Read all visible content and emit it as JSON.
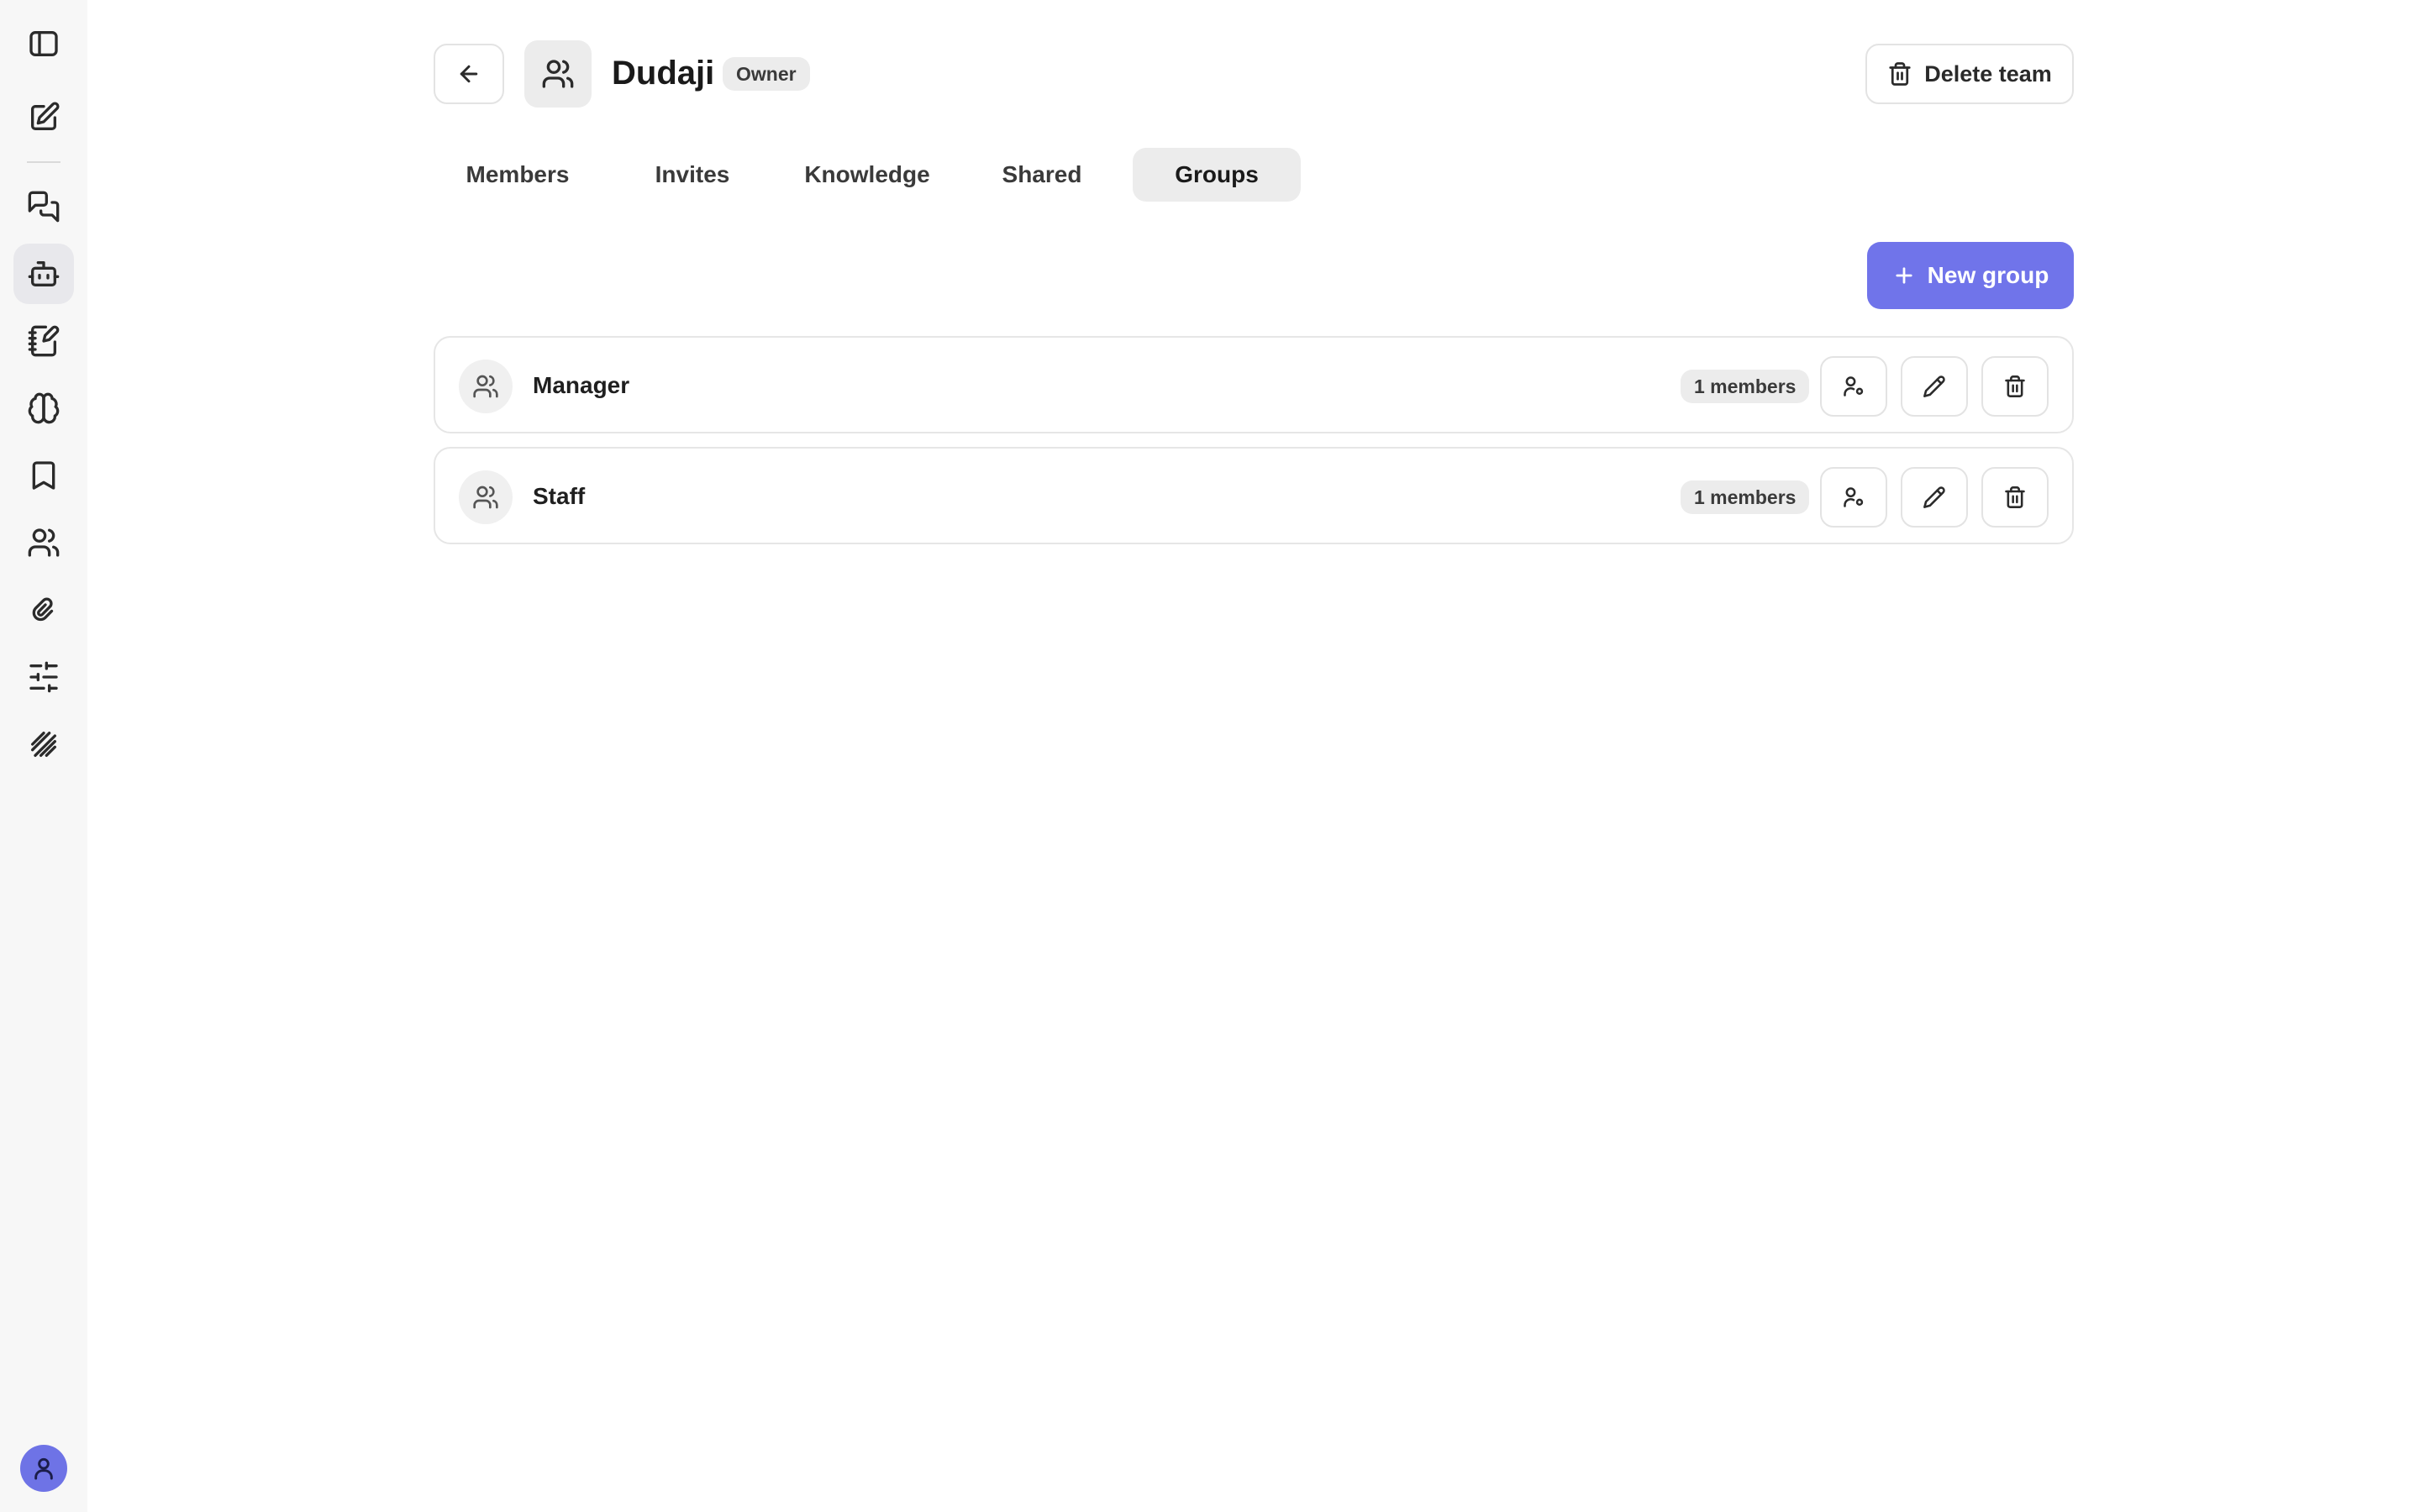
{
  "sidebar": {
    "items": [
      {
        "icon": "sidebar-toggle-icon"
      },
      {
        "icon": "new-chat-icon"
      },
      {
        "icon": "chats-icon"
      },
      {
        "icon": "bot-icon",
        "active": true
      },
      {
        "icon": "notebook-icon"
      },
      {
        "icon": "brain-icon"
      },
      {
        "icon": "bookmark-icon"
      },
      {
        "icon": "users-icon"
      },
      {
        "icon": "paperclip-icon"
      },
      {
        "icon": "sliders-icon"
      },
      {
        "icon": "scribble-icon"
      }
    ],
    "avatar_icon": "user-icon"
  },
  "header": {
    "team_name": "Dudaji",
    "role_badge": "Owner",
    "delete_label": "Delete team"
  },
  "tabs": [
    {
      "label": "Members"
    },
    {
      "label": "Invites"
    },
    {
      "label": "Knowledge"
    },
    {
      "label": "Shared"
    },
    {
      "label": "Groups",
      "active": true
    }
  ],
  "actions": {
    "new_group_label": "New group"
  },
  "groups": [
    {
      "name": "Manager",
      "members": "1 members"
    },
    {
      "name": "Staff",
      "members": "1 members"
    }
  ],
  "colors": {
    "accent": "#7074ea",
    "sidebar_bg": "#f7f7f7",
    "badge_bg": "#ececec"
  }
}
